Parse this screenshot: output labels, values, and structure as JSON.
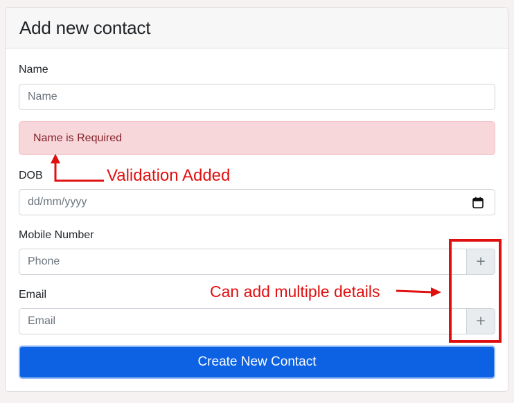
{
  "form": {
    "title": "Add new contact",
    "name": {
      "label": "Name",
      "placeholder": "Name"
    },
    "alert": {
      "text": "Name is Required"
    },
    "dob": {
      "label": "DOB",
      "placeholder": "dd/mm/yyyy",
      "icon": "calendar-icon"
    },
    "mobile": {
      "label": "Mobile Number",
      "placeholder": "Phone",
      "add_label": "+"
    },
    "email": {
      "label": "Email",
      "placeholder": "Email",
      "add_label": "+"
    },
    "submit_label": "Create New Contact"
  },
  "annotations": {
    "validation": "Validation Added",
    "multiple": "Can add multiple details",
    "color": "#e01010"
  },
  "colors": {
    "primary": "#0d62e3",
    "alert_bg": "#f8d7da",
    "alert_text": "#842029"
  }
}
